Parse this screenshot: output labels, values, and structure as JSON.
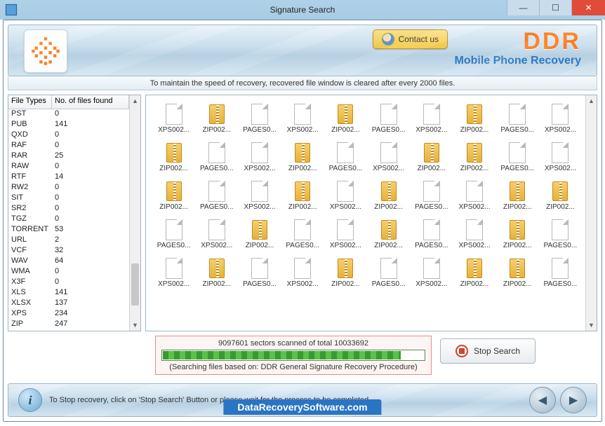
{
  "window": {
    "title": "Signature Search"
  },
  "banner": {
    "contact_label": "Contact us",
    "brand": "DDR",
    "subbrand": "Mobile Phone Recovery"
  },
  "info_strip": "To maintain the speed of recovery, recovered file window is cleared after every 2000 files.",
  "table": {
    "col1": "File Types",
    "col2": "No. of files found",
    "rows": [
      {
        "type": "PST",
        "count": "0"
      },
      {
        "type": "PUB",
        "count": "141"
      },
      {
        "type": "QXD",
        "count": "0"
      },
      {
        "type": "RAF",
        "count": "0"
      },
      {
        "type": "RAR",
        "count": "25"
      },
      {
        "type": "RAW",
        "count": "0"
      },
      {
        "type": "RTF",
        "count": "14"
      },
      {
        "type": "RW2",
        "count": "0"
      },
      {
        "type": "SIT",
        "count": "0"
      },
      {
        "type": "SR2",
        "count": "0"
      },
      {
        "type": "TGZ",
        "count": "0"
      },
      {
        "type": "TORRENT",
        "count": "53"
      },
      {
        "type": "URL",
        "count": "2"
      },
      {
        "type": "VCF",
        "count": "32"
      },
      {
        "type": "WAV",
        "count": "64"
      },
      {
        "type": "WMA",
        "count": "0"
      },
      {
        "type": "X3F",
        "count": "0"
      },
      {
        "type": "XLS",
        "count": "141"
      },
      {
        "type": "XLSX",
        "count": "137"
      },
      {
        "type": "XPS",
        "count": "234"
      },
      {
        "type": "ZIP",
        "count": "247"
      }
    ]
  },
  "files": [
    {
      "k": "doc",
      "n": "XPS002..."
    },
    {
      "k": "zip",
      "n": "ZIP002..."
    },
    {
      "k": "doc",
      "n": "PAGES0..."
    },
    {
      "k": "doc",
      "n": "XPS002..."
    },
    {
      "k": "zip",
      "n": "ZIP002..."
    },
    {
      "k": "doc",
      "n": "PAGES0..."
    },
    {
      "k": "doc",
      "n": "XPS002..."
    },
    {
      "k": "zip",
      "n": "ZIP002..."
    },
    {
      "k": "doc",
      "n": "PAGES0..."
    },
    {
      "k": "doc",
      "n": "XPS002..."
    },
    {
      "k": "zip",
      "n": "ZIP002..."
    },
    {
      "k": "doc",
      "n": "PAGES0..."
    },
    {
      "k": "doc",
      "n": "XPS002..."
    },
    {
      "k": "zip",
      "n": "ZIP002..."
    },
    {
      "k": "doc",
      "n": "PAGES0..."
    },
    {
      "k": "doc",
      "n": "XPS002..."
    },
    {
      "k": "zip",
      "n": "ZIP002..."
    },
    {
      "k": "zip",
      "n": "ZIP002..."
    },
    {
      "k": "doc",
      "n": "PAGES0..."
    },
    {
      "k": "doc",
      "n": "XPS002..."
    },
    {
      "k": "zip",
      "n": "ZIP002..."
    },
    {
      "k": "doc",
      "n": "PAGES0..."
    },
    {
      "k": "doc",
      "n": "XPS002..."
    },
    {
      "k": "zip",
      "n": "ZIP002..."
    },
    {
      "k": "doc",
      "n": "XPS002..."
    },
    {
      "k": "zip",
      "n": "ZIP002..."
    },
    {
      "k": "doc",
      "n": "PAGES0..."
    },
    {
      "k": "doc",
      "n": "XPS002..."
    },
    {
      "k": "zip",
      "n": "ZIP002..."
    },
    {
      "k": "zip",
      "n": "ZIP002..."
    },
    {
      "k": "doc",
      "n": "PAGES0..."
    },
    {
      "k": "doc",
      "n": "XPS002..."
    },
    {
      "k": "zip",
      "n": "ZIP002..."
    },
    {
      "k": "doc",
      "n": "PAGES0..."
    },
    {
      "k": "doc",
      "n": "XPS002..."
    },
    {
      "k": "zip",
      "n": "ZIP002..."
    },
    {
      "k": "doc",
      "n": "PAGES0..."
    },
    {
      "k": "doc",
      "n": "XPS002..."
    },
    {
      "k": "zip",
      "n": "ZIP002..."
    },
    {
      "k": "doc",
      "n": "PAGES0..."
    },
    {
      "k": "doc",
      "n": "XPS002..."
    },
    {
      "k": "zip",
      "n": "ZIP002..."
    },
    {
      "k": "doc",
      "n": "PAGES0..."
    },
    {
      "k": "doc",
      "n": "XPS002..."
    },
    {
      "k": "zip",
      "n": "ZIP002..."
    },
    {
      "k": "doc",
      "n": "PAGES0..."
    },
    {
      "k": "doc",
      "n": "XPS002..."
    },
    {
      "k": "zip",
      "n": "ZIP002..."
    },
    {
      "k": "zip",
      "n": "ZIP002..."
    },
    {
      "k": "doc",
      "n": "PAGES0..."
    }
  ],
  "progress": {
    "sectors_line": "9097601 sectors scanned of total 10033692",
    "search_mode": "(Searching files based on:  DDR General Signature Recovery Procedure)",
    "percent": 91
  },
  "stop_label": "Stop Search",
  "footer": {
    "msg": "To Stop recovery, click on 'Stop Search' Button or please wait for the process to be completed.",
    "watermark": "DataRecoverySoftware.com"
  }
}
